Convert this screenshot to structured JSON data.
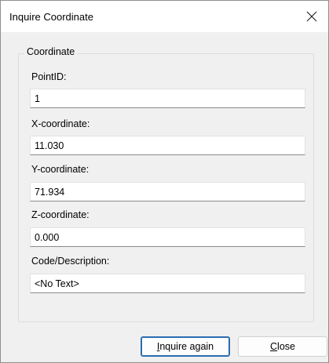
{
  "window": {
    "title": "Inquire Coordinate",
    "close_symbol": "×"
  },
  "group": {
    "legend": "Coordinate"
  },
  "fields": [
    {
      "label": "PointID:",
      "value": "1"
    },
    {
      "label": "X-coordinate:",
      "value": "11.030"
    },
    {
      "label": "Y-coordinate:",
      "value": "71.934"
    },
    {
      "label": "Z-coordinate:",
      "value": "0.000"
    },
    {
      "label": "Code/Description:",
      "value": "<No Text>"
    }
  ],
  "buttons": {
    "inquire_again": {
      "mnemonic": "I",
      "rest": "nquire again"
    },
    "close": {
      "mnemonic": "C",
      "rest": "lose"
    }
  },
  "colors": {
    "dialog_background": "#f0f0f0",
    "titlebar_background": "#ffffff",
    "default_button_border": "#2b6cb0"
  },
  "icons": {
    "close": "close-icon"
  }
}
